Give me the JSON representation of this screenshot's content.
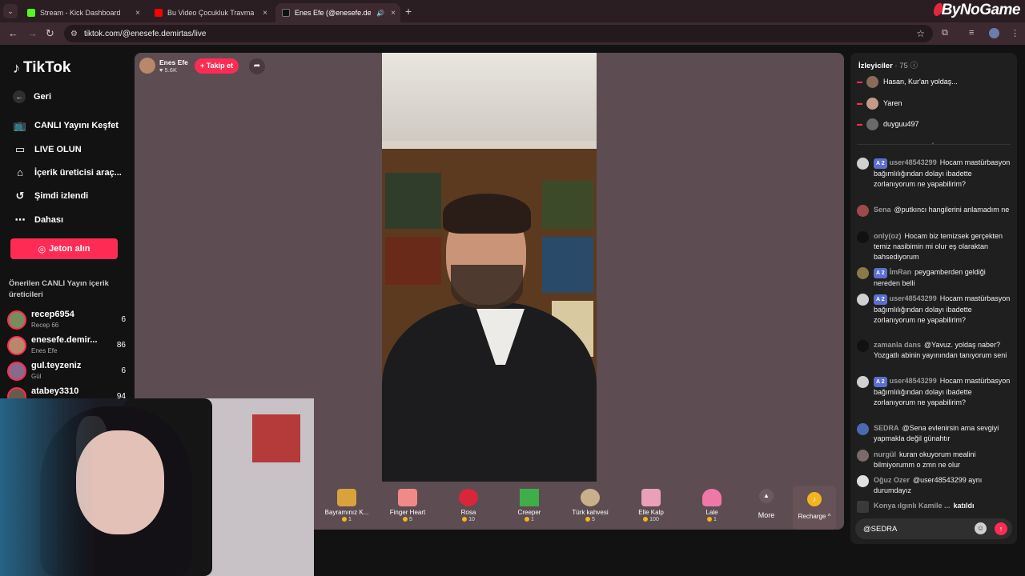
{
  "browser": {
    "tabs": [
      {
        "title": "Stream - Kick Dashboard",
        "favicon_color": "#53fc18"
      },
      {
        "title": "Bu Video Çocukluk Travmamdı",
        "favicon_color": "#ff0000"
      },
      {
        "title": "Enes Efe (@enesefe.demirtas)",
        "favicon_color": "#111111"
      }
    ],
    "close_glyph": "×",
    "new_tab": "+",
    "url": "tiktok.com/@enesefe.demirtas/live",
    "brand": "ByNoGame"
  },
  "sidebar": {
    "logo": "TikTok",
    "back": "Geri",
    "nav": [
      {
        "label": "CANLI Yayını Keşfet",
        "icon": "tv-icon"
      },
      {
        "label": "LIVE OLUN",
        "icon": "camera-icon"
      },
      {
        "label": "İçerik üreticisi araç...",
        "icon": "home-icon"
      },
      {
        "label": "Şimdi izlendi",
        "icon": "history-icon"
      },
      {
        "label": "Dahası",
        "icon": "more-icon"
      }
    ],
    "coin_button": "Jeton alın",
    "recommended_title": "Önerilen CANLI Yayın içerik üreticileri",
    "creators": [
      {
        "name": "recep6954",
        "sub": "Recep 66",
        "count": "6"
      },
      {
        "name": "enesefe.demir...",
        "sub": "Enes Efe",
        "count": "86"
      },
      {
        "name": "gul.teyzeniz",
        "sub": "Gül",
        "count": "6"
      },
      {
        "name": "atabey3310",
        "sub": "",
        "count": "94"
      }
    ]
  },
  "stream": {
    "host_name": "Enes Efe",
    "host_likes": "♥ 5.6K",
    "follow_label": "+ Takip et",
    "gifts": [
      {
        "name": "Bayramınız K...",
        "price": "1",
        "color": "#d9a23c"
      },
      {
        "name": "Finger Heart",
        "price": "5",
        "color": "#f08a8a"
      },
      {
        "name": "Rosa",
        "price": "10",
        "color": "#d8263a"
      },
      {
        "name": "Creeper",
        "price": "1",
        "color": "#3fae4a"
      },
      {
        "name": "Türk kahvesi",
        "price": "5",
        "color": "#c8b18a"
      },
      {
        "name": "Elle Kalp",
        "price": "100",
        "color": "#e9a0b8"
      },
      {
        "name": "Lale",
        "price": "1",
        "color": "#f078a8"
      }
    ],
    "more_label": "More",
    "recharge_label": "Recharge ^"
  },
  "panel": {
    "viewers_title": "İzleyiciler",
    "viewers_count": "· 75",
    "viewers": [
      {
        "name": "Hasan, Kur'an yoldaş...",
        "color": "#8a6b5a"
      },
      {
        "name": "Yaren",
        "color": "#c49a88"
      },
      {
        "name": "duyguu497",
        "color": "#6a6a6a"
      }
    ],
    "messages": [
      {
        "user": "user48543299",
        "badge": "A 2",
        "text": "Hocam mastürbasyon bağımlılığından dolayı ibadette zorlanıyorum ne yapabilirim?",
        "color": "#d0d0d0"
      },
      {
        "user": "Sena",
        "badge": "",
        "text": "@putkıncı hangilerini anlamadım ne",
        "color": "#9c4a4a"
      },
      {
        "user": "only(oz)",
        "badge": "",
        "text": "Hocam biz temizsek gerçekten temiz nasibimin mi olur eş olaraktan bahsediyorum",
        "color": "#111111"
      },
      {
        "user": "İmRan",
        "badge": "A 2",
        "text": "peygamberden geldiği nereden belli",
        "color": "#8a7a4a"
      },
      {
        "user": "user48543299",
        "badge": "A 2",
        "text": "Hocam mastürbasyon bağımlılığından dolayı ibadette zorlanıyorum ne yapabilirim?",
        "color": "#d0d0d0"
      },
      {
        "user": "zamanla dans",
        "badge": "",
        "text": "@Yavuz. yoldaş naber? Yozgatlı abinin yayınından tanıyorum seni",
        "color": "#111111"
      },
      {
        "user": "user48543299",
        "badge": "A 2",
        "text": "Hocam mastürbasyon bağımlılığından dolayı ibadette zorlanıyorum ne yapabilirim?",
        "color": "#d0d0d0"
      },
      {
        "user": "SEDRA",
        "badge": "",
        "text": "@Sena evlenirsin ama sevgiyi yapmakla değil günahtır",
        "color": "#4a6ab0"
      },
      {
        "user": "nurgül",
        "badge": "",
        "text": "kuran okuyorum mealini bilmiyorumm o zmn ne olur",
        "color": "#7a6a6a"
      },
      {
        "user": "Oğuz Ozer",
        "badge": "",
        "text": "@user48543299 aynı durumdayız",
        "color": "#e0e0e0"
      },
      {
        "user": "Konya ılgınlı Kamile ...",
        "badge": "",
        "text": "katıldı",
        "color": "#3a3a3a"
      }
    ],
    "input_value": "@SEDRA"
  }
}
